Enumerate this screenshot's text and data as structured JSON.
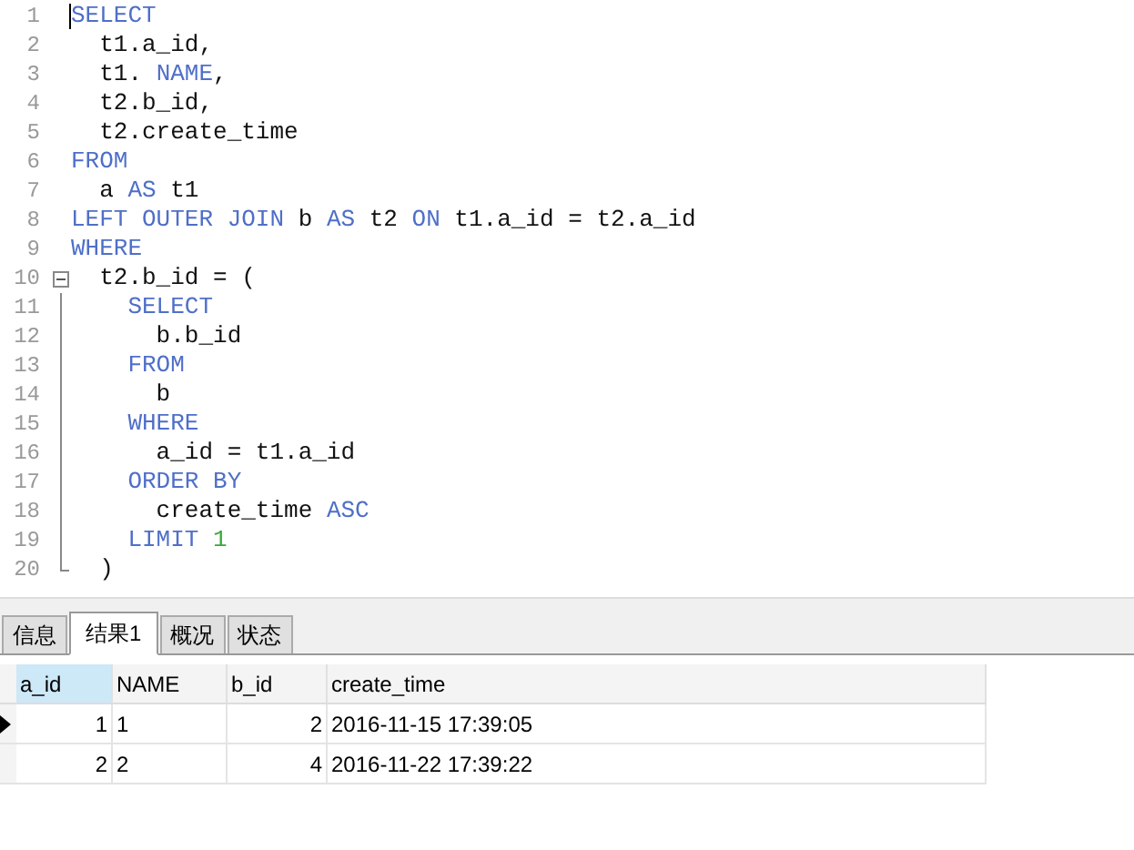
{
  "editor": {
    "lines": [
      {
        "kind": "code",
        "number": "1",
        "tokens": [
          {
            "kind": "keyword",
            "text": "SELECT"
          }
        ]
      },
      {
        "kind": "code",
        "number": "2",
        "tokens": [
          {
            "kind": "plain",
            "text": "  t1.a_id,"
          }
        ]
      },
      {
        "kind": "code",
        "number": "3",
        "tokens": [
          {
            "kind": "plain",
            "text": "  t1. "
          },
          {
            "kind": "keyword",
            "text": "NAME"
          },
          {
            "kind": "plain",
            "text": ","
          }
        ]
      },
      {
        "kind": "code",
        "number": "4",
        "tokens": [
          {
            "kind": "plain",
            "text": "  t2.b_id,"
          }
        ]
      },
      {
        "kind": "code",
        "number": "5",
        "tokens": [
          {
            "kind": "plain",
            "text": "  t2.create_time"
          }
        ]
      },
      {
        "kind": "code",
        "number": "6",
        "tokens": [
          {
            "kind": "keyword",
            "text": "FROM"
          }
        ]
      },
      {
        "kind": "code",
        "number": "7",
        "tokens": [
          {
            "kind": "plain",
            "text": "  a "
          },
          {
            "kind": "keyword",
            "text": "AS"
          },
          {
            "kind": "plain",
            "text": " t1"
          }
        ]
      },
      {
        "kind": "code",
        "number": "8",
        "tokens": [
          {
            "kind": "keyword",
            "text": "LEFT OUTER JOIN"
          },
          {
            "kind": "plain",
            "text": " b "
          },
          {
            "kind": "keyword",
            "text": "AS"
          },
          {
            "kind": "plain",
            "text": " t2 "
          },
          {
            "kind": "keyword",
            "text": "ON"
          },
          {
            "kind": "plain",
            "text": " t1.a_id = t2.a_id"
          }
        ]
      },
      {
        "kind": "code",
        "number": "9",
        "tokens": [
          {
            "kind": "keyword",
            "text": "WHERE"
          }
        ]
      },
      {
        "kind": "foldstart",
        "number": "10",
        "tokens": [
          {
            "kind": "plain",
            "text": "  t2.b_id = ("
          }
        ]
      },
      {
        "kind": "foldbody",
        "number": "11",
        "tokens": [
          {
            "kind": "keyword",
            "text": "    SELECT"
          }
        ]
      },
      {
        "kind": "foldbody",
        "number": "12",
        "tokens": [
          {
            "kind": "plain",
            "text": "      b.b_id"
          }
        ]
      },
      {
        "kind": "foldbody",
        "number": "13",
        "tokens": [
          {
            "kind": "keyword",
            "text": "    FROM"
          }
        ]
      },
      {
        "kind": "foldbody",
        "number": "14",
        "tokens": [
          {
            "kind": "plain",
            "text": "      b"
          }
        ]
      },
      {
        "kind": "foldbody",
        "number": "15",
        "tokens": [
          {
            "kind": "keyword",
            "text": "    WHERE"
          }
        ]
      },
      {
        "kind": "foldbody",
        "number": "16",
        "tokens": [
          {
            "kind": "plain",
            "text": "      a_id = t1.a_id"
          }
        ]
      },
      {
        "kind": "foldbody",
        "number": "17",
        "tokens": [
          {
            "kind": "keyword",
            "text": "    ORDER BY"
          }
        ]
      },
      {
        "kind": "foldbody",
        "number": "18",
        "tokens": [
          {
            "kind": "plain",
            "text": "      create_time "
          },
          {
            "kind": "keyword",
            "text": "ASC"
          }
        ]
      },
      {
        "kind": "foldbody",
        "number": "19",
        "tokens": [
          {
            "kind": "keyword",
            "text": "    LIMIT "
          },
          {
            "kind": "number",
            "text": "1"
          }
        ]
      },
      {
        "kind": "foldend",
        "number": "20",
        "tokens": [
          {
            "kind": "plain",
            "text": "  )"
          }
        ]
      }
    ]
  },
  "tabs": [
    {
      "label": "信息",
      "selected": false
    },
    {
      "label": "结果1",
      "selected": true
    },
    {
      "label": "概况",
      "selected": false
    },
    {
      "label": "状态",
      "selected": false
    }
  ],
  "table": {
    "columns": [
      {
        "label": "a_id",
        "selected": true,
        "kind": "numeric"
      },
      {
        "label": "NAME",
        "selected": false,
        "kind": "text"
      },
      {
        "label": "b_id",
        "selected": false,
        "kind": "numeric"
      },
      {
        "label": "create_time",
        "selected": false,
        "kind": "text"
      }
    ],
    "rows": [
      {
        "current": true,
        "cells": [
          "1",
          "1",
          "2",
          "2016-11-15 17:39:05"
        ]
      },
      {
        "current": false,
        "cells": [
          "2",
          "2",
          "4",
          "2016-11-22 17:39:22"
        ]
      }
    ]
  }
}
